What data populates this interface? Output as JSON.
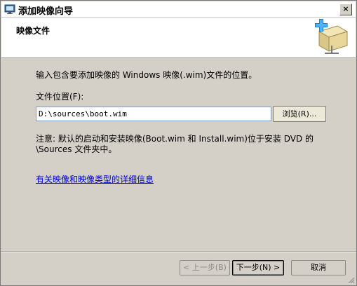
{
  "window": {
    "title": "添加映像向导",
    "close_label": "×"
  },
  "header": {
    "title": "映像文件"
  },
  "main": {
    "instruction": "输入包含要添加映像的 Windows 映像(.wim)文件的位置。",
    "location_label": "文件位置(F):",
    "location_value": "D:\\sources\\boot.wim",
    "browse_label": "浏览(R)...",
    "note": "注意: 默认的启动和安装映像(Boot.wim 和 Install.wim)位于安装 DVD 的 \\Sources 文件夹中。",
    "link_text": "有关映像和映像类型的详细信息"
  },
  "footer": {
    "back_label": "< 上一步(B)",
    "next_label": "下一步(N) >",
    "cancel_label": "取消"
  },
  "icons": {
    "title": "monitor-wizard-icon",
    "header": "add-image-package-icon",
    "close": "close-icon"
  },
  "colors": {
    "link": "#0000cc",
    "dialog_bg": "#d4d0c8",
    "header_bg": "#ffffff"
  }
}
